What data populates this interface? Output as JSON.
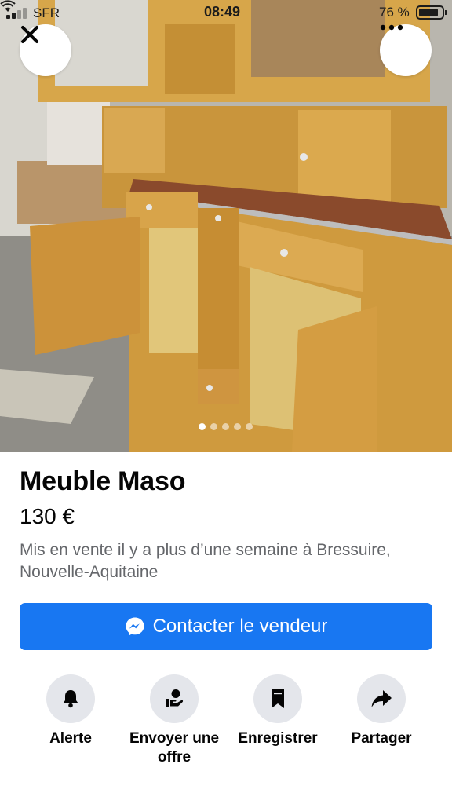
{
  "status_bar": {
    "carrier": "SFR",
    "time": "08:49",
    "battery_percent": "76 %",
    "battery_level": 0.76
  },
  "photo": {
    "description_icon": "furniture-photo",
    "pager": {
      "count": 5,
      "active_index": 0
    }
  },
  "listing": {
    "title": "Meuble Maso",
    "price": "130 €",
    "location": "Mis en vente il y a plus d’une semaine à Bressuire, Nouvelle-Aquitaine"
  },
  "contact": {
    "label": "Contacter le vendeur",
    "icon": "messenger-icon",
    "color": "#1877f2"
  },
  "actions": [
    {
      "label": "Alerte",
      "icon": "bell-icon"
    },
    {
      "label": "Envoyer une offre",
      "icon": "offer-hand-icon"
    },
    {
      "label": "Enregistrer",
      "icon": "bookmark-icon"
    },
    {
      "label": "Partager",
      "icon": "share-arrow-icon"
    }
  ]
}
